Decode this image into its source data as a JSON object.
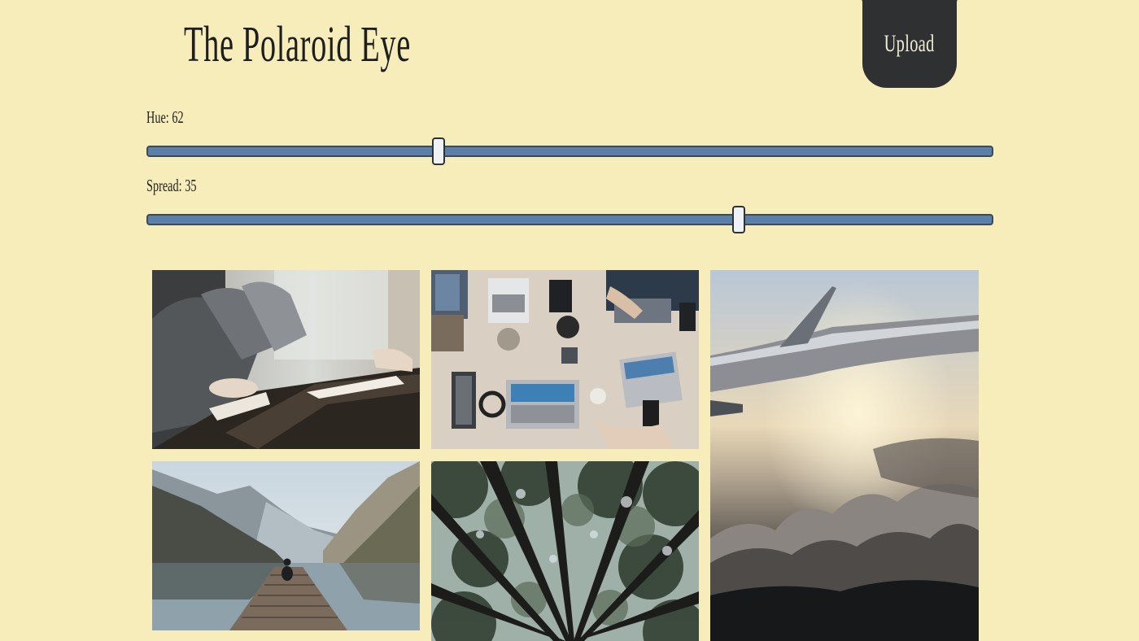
{
  "header": {
    "title": "The Polaroid Eye",
    "upload_label": "Upload"
  },
  "controls": {
    "hue": {
      "label": "Hue: 62",
      "value": 62,
      "min": 0,
      "max": 180
    },
    "spread": {
      "label": "Spread: 35",
      "value": 35,
      "min": 0,
      "max": 50
    }
  },
  "gallery": {
    "images": [
      {
        "name": "people-writing-at-table-photo"
      },
      {
        "name": "laptops-on-desk-photo"
      },
      {
        "name": "airplane-wing-clouds-photo"
      },
      {
        "name": "lake-mountains-pier-photo"
      },
      {
        "name": "forest-canopy-photo"
      }
    ]
  },
  "colors": {
    "background": "#f6edba",
    "button": "#2e3032",
    "slider_track": "#5a7fa8"
  }
}
